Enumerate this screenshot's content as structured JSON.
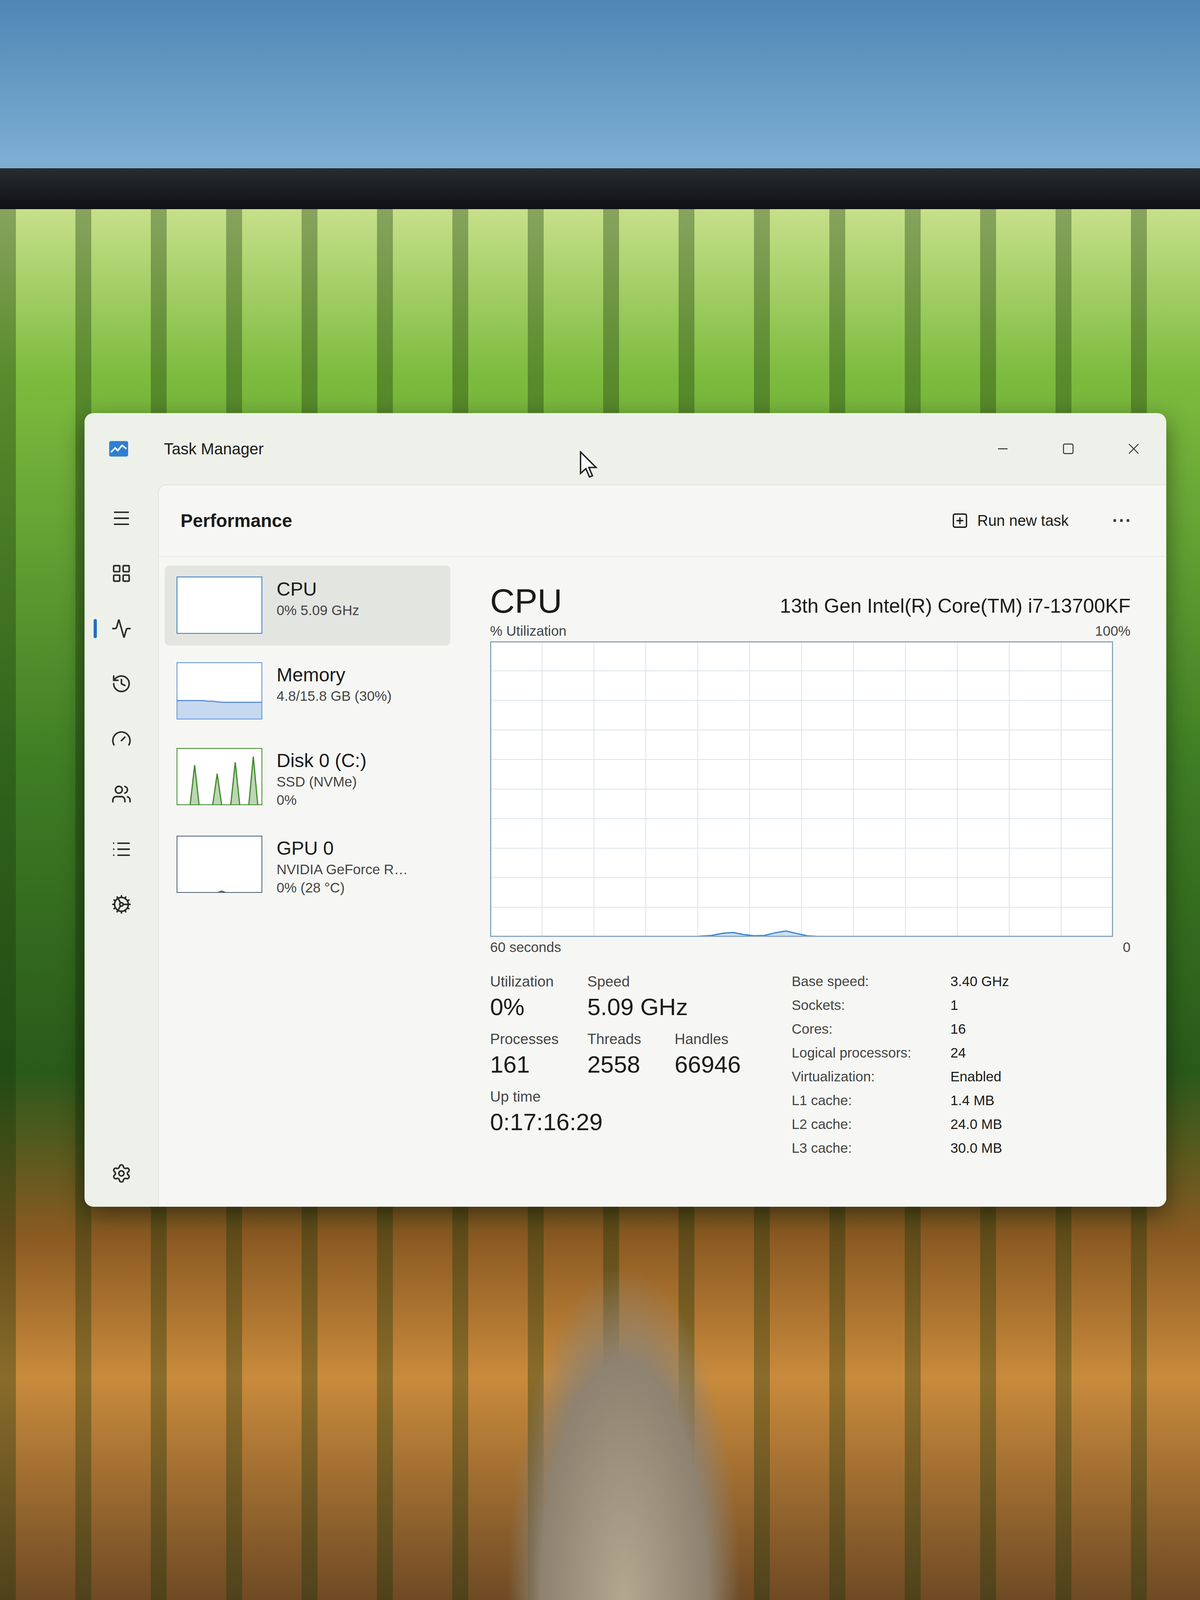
{
  "window": {
    "title": "Task Manager"
  },
  "nav": [
    {
      "kind": "menu",
      "selected": false
    },
    {
      "kind": "processes",
      "selected": false
    },
    {
      "kind": "performance",
      "selected": true
    },
    {
      "kind": "history",
      "selected": false
    },
    {
      "kind": "startup",
      "selected": false
    },
    {
      "kind": "users",
      "selected": false
    },
    {
      "kind": "details",
      "selected": false
    },
    {
      "kind": "services",
      "selected": false
    },
    {
      "kind": "settings",
      "selected": false
    }
  ],
  "header": {
    "title": "Performance",
    "action": "Run new task",
    "more": "···"
  },
  "devices": [
    {
      "name": "CPU",
      "lines": [
        "0% 5.09 GHz"
      ],
      "selected": true,
      "color": "#2f7fd1",
      "graph": [
        0,
        0,
        0,
        0,
        0,
        0,
        0,
        0,
        0,
        0,
        0,
        0,
        0,
        0,
        0,
        0,
        0,
        0,
        0,
        0
      ]
    },
    {
      "name": "Memory",
      "lines": [
        "4.8/15.8 GB (30%)"
      ],
      "selected": false,
      "color": "#5f8fd8",
      "graph": [
        33,
        33,
        33,
        33,
        33,
        33,
        33,
        32,
        32,
        31,
        30,
        30,
        30,
        30,
        30,
        30,
        30,
        30,
        30,
        30
      ]
    },
    {
      "name": "Disk 0 (C:)",
      "lines": [
        "SSD (NVMe)",
        "0%"
      ],
      "selected": false,
      "color": "#3f8a2a",
      "graph": [
        0,
        0,
        0,
        0,
        70,
        0,
        0,
        0,
        0,
        55,
        0,
        0,
        0,
        75,
        0,
        0,
        0,
        85,
        0,
        0
      ]
    },
    {
      "name": "GPU 0",
      "lines": [
        "NVIDIA GeForce R…",
        "0% (28 °C)"
      ],
      "selected": false,
      "color": "#4a5f73",
      "graph": [
        0,
        0,
        0,
        0,
        0,
        0,
        0,
        0,
        0,
        0,
        3,
        0,
        0,
        0,
        0,
        0,
        0,
        0,
        0,
        0
      ]
    }
  ],
  "chart": {
    "title": "CPU",
    "model": "13th Gen Intel(R) Core(TM) i7-13700KF",
    "y_label": "% Utilization",
    "y_max": "100%",
    "x_label": "60 seconds",
    "x_min": "0",
    "values": [
      0,
      0,
      0,
      0,
      0,
      0,
      0,
      0,
      0,
      0,
      0,
      0,
      0,
      0,
      0,
      0,
      0,
      0,
      0,
      0,
      0.3,
      0.5,
      1.2,
      1.5,
      0.8,
      0.4,
      0.5,
      1.4,
      2,
      1.2,
      0.4,
      0.2,
      0,
      0,
      0,
      0,
      0,
      0,
      0,
      0,
      0,
      0,
      0,
      0,
      0,
      0,
      0,
      0,
      0,
      0,
      0,
      0,
      0,
      0,
      0,
      0,
      0,
      0,
      0,
      0
    ]
  },
  "stats": [
    [
      {
        "label": "Utilization",
        "value": "0%"
      },
      {
        "label": "Speed",
        "value": "5.09 GHz"
      }
    ],
    [
      {
        "label": "Processes",
        "value": "161"
      },
      {
        "label": "Threads",
        "value": "2558"
      },
      {
        "label": "Handles",
        "value": "66946"
      }
    ],
    [
      {
        "label": "Up time",
        "value": "0:17:16:29"
      }
    ]
  ],
  "specs": [
    {
      "label": "Base speed:",
      "value": "3.40 GHz"
    },
    {
      "label": "Sockets:",
      "value": "1"
    },
    {
      "label": "Cores:",
      "value": "16"
    },
    {
      "label": "Logical processors:",
      "value": "24"
    },
    {
      "label": "Virtualization:",
      "value": "Enabled"
    },
    {
      "label": "L1 cache:",
      "value": "1.4 MB"
    },
    {
      "label": "L2 cache:",
      "value": "24.0 MB"
    },
    {
      "label": "L3 cache:",
      "value": "30.0 MB"
    }
  ]
}
